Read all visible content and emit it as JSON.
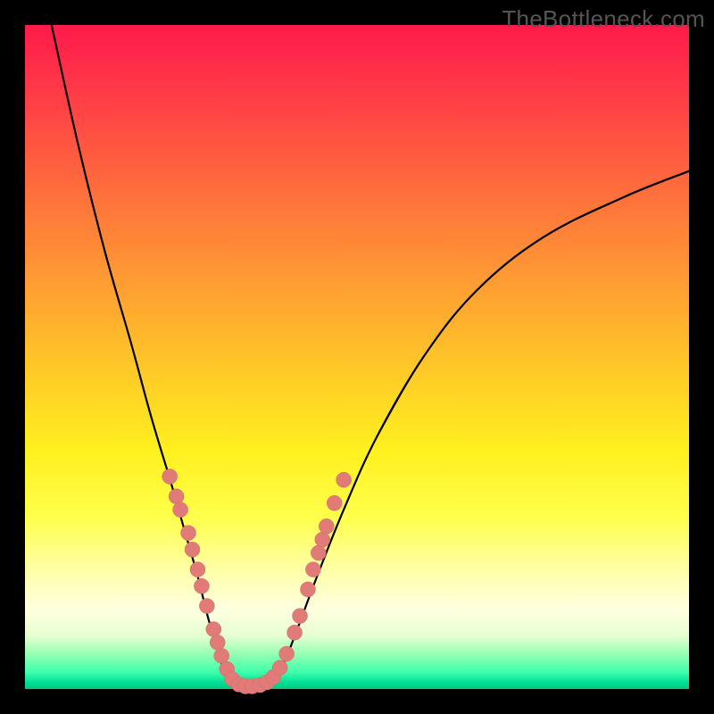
{
  "watermark": "TheBottleneck.com",
  "chart_data": {
    "type": "line",
    "title": "",
    "xlabel": "",
    "ylabel": "",
    "ylim": [
      0,
      100
    ],
    "xlim": [
      0,
      100
    ],
    "series": [
      {
        "name": "left-branch",
        "x": [
          4,
          8,
          12,
          16,
          19,
          22,
          24,
          26,
          27.5,
          29,
          30,
          31
        ],
        "y": [
          100,
          82,
          66,
          52,
          41,
          31,
          24,
          17,
          11,
          6,
          2.5,
          0.8
        ]
      },
      {
        "name": "valley-floor",
        "x": [
          31,
          32.5,
          34,
          35.5,
          37
        ],
        "y": [
          0.8,
          0.4,
          0.3,
          0.4,
          0.8
        ]
      },
      {
        "name": "right-branch",
        "x": [
          37,
          39,
          41,
          44,
          48,
          53,
          60,
          68,
          78,
          90,
          100
        ],
        "y": [
          0.8,
          4,
          9,
          17,
          27,
          38,
          50,
          60,
          68,
          74,
          78
        ]
      }
    ],
    "markers": {
      "name": "highlighted-points",
      "points": [
        {
          "x": 21.8,
          "y": 32
        },
        {
          "x": 22.8,
          "y": 29
        },
        {
          "x": 23.4,
          "y": 27
        },
        {
          "x": 24.6,
          "y": 23.5
        },
        {
          "x": 25.2,
          "y": 21
        },
        {
          "x": 26.0,
          "y": 18
        },
        {
          "x": 26.6,
          "y": 15.5
        },
        {
          "x": 27.4,
          "y": 12.5
        },
        {
          "x": 28.4,
          "y": 9
        },
        {
          "x": 29.0,
          "y": 7
        },
        {
          "x": 29.6,
          "y": 5
        },
        {
          "x": 30.4,
          "y": 3
        },
        {
          "x": 31.2,
          "y": 1.5
        },
        {
          "x": 32.2,
          "y": 0.7
        },
        {
          "x": 33.2,
          "y": 0.4
        },
        {
          "x": 34.2,
          "y": 0.4
        },
        {
          "x": 35.4,
          "y": 0.6
        },
        {
          "x": 36.4,
          "y": 1.0
        },
        {
          "x": 37.4,
          "y": 1.8
        },
        {
          "x": 38.4,
          "y": 3.2
        },
        {
          "x": 39.4,
          "y": 5.3
        },
        {
          "x": 40.6,
          "y": 8.5
        },
        {
          "x": 41.4,
          "y": 11
        },
        {
          "x": 42.6,
          "y": 15
        },
        {
          "x": 43.4,
          "y": 18
        },
        {
          "x": 44.2,
          "y": 20.5
        },
        {
          "x": 44.8,
          "y": 22.5
        },
        {
          "x": 45.4,
          "y": 24.5
        },
        {
          "x": 46.6,
          "y": 28
        },
        {
          "x": 48.0,
          "y": 31.5
        }
      ]
    },
    "background_gradient": {
      "top": "#ff1a4b",
      "mid": "#fff01f",
      "bottom": "#00c77f"
    }
  }
}
